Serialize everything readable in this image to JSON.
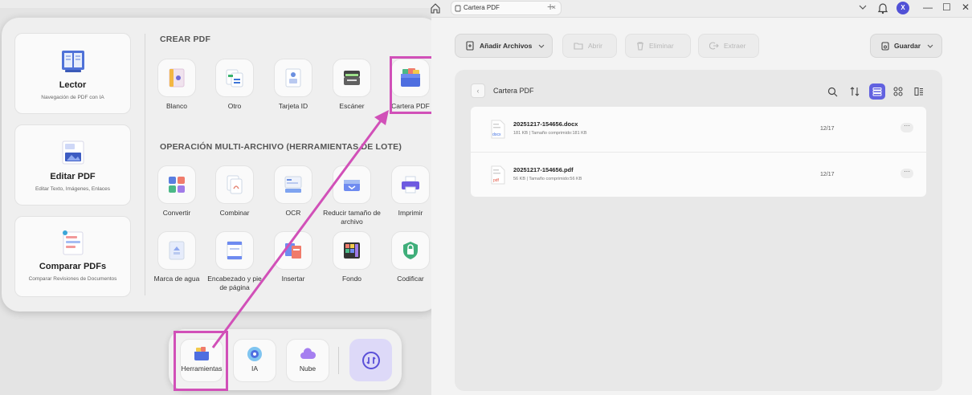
{
  "tools_panel": {
    "side_cards": [
      {
        "title": "Lector",
        "subtitle": "Navegación de PDF con IA"
      },
      {
        "title": "Editar PDF",
        "subtitle": "Editar Texto, Imágenes, Enlaces"
      },
      {
        "title": "Comparar PDFs",
        "subtitle": "Comparar Revisiones de Documentos"
      }
    ],
    "crear_pdf": {
      "heading": "CREAR PDF",
      "items": [
        "Blanco",
        "Otro",
        "Tarjeta ID",
        "Escáner",
        "Cartera PDF"
      ]
    },
    "multi": {
      "heading": "OPERACIÓN MULTI-ARCHIVO (HERRAMIENTAS DE LOTE)",
      "items": [
        "Convertir",
        "Combinar",
        "OCR",
        "Reducir tamaño de archivo",
        "Imprimir",
        "Marca de agua",
        "Encabezado y pie de página",
        "Insertar",
        "Fondo",
        "Codificar"
      ]
    }
  },
  "dock": {
    "items": [
      "Herramientas",
      "IA",
      "Nube"
    ]
  },
  "app": {
    "tab_title": "Cartera PDF",
    "tab_close": "×",
    "tab_add": "+",
    "user_initial": "X",
    "window_controls": {
      "min": "—",
      "max": "☐",
      "close": "✕"
    },
    "toolbar": {
      "add_files": "Añadir Archivos",
      "open": "Abrir",
      "delete": "Eliminar",
      "extract": "Extraer",
      "save": "Guardar"
    },
    "folder_title": "Cartera PDF",
    "back_glyph": "‹",
    "files": [
      {
        "name": "20251217-154656.docx",
        "meta": "181 KB | Tamaño comprimido:181 KB",
        "date": "12/17",
        "more": "···",
        "ext": "docx"
      },
      {
        "name": "20251217-154656.pdf",
        "meta": "56 KB | Tamaño comprimido:56 KB",
        "date": "12/17",
        "more": "···",
        "ext": "pdf"
      }
    ]
  },
  "colors": {
    "highlight": "#d150b8",
    "accent": "#6262e0",
    "avatar": "#5151d6"
  },
  "icons": [
    "home-icon",
    "document-icon",
    "bell-icon",
    "search-icon",
    "sort-icon",
    "list-view-icon",
    "grid-view-icon",
    "detail-view-icon",
    "add-file-icon",
    "folder-icon",
    "trash-icon",
    "extract-icon",
    "save-icon",
    "sync-icon"
  ]
}
